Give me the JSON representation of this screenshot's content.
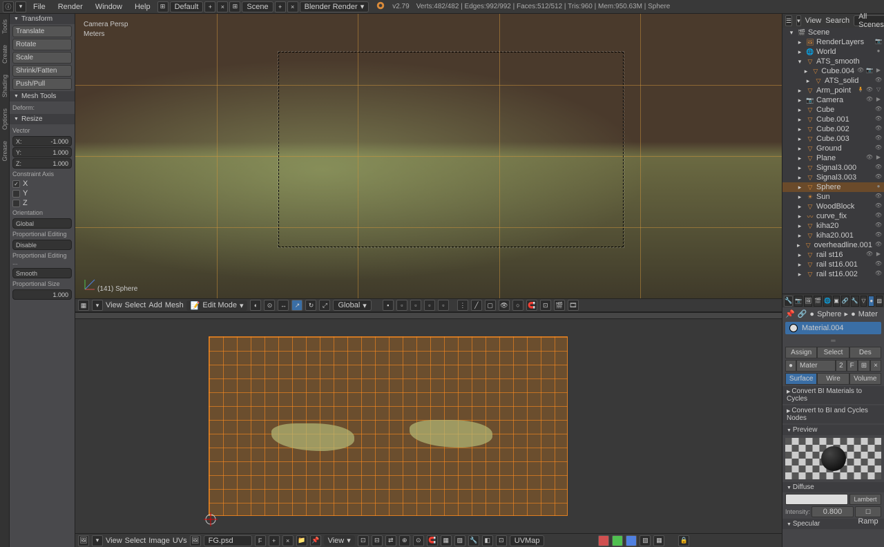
{
  "app": {
    "version": "v2.79",
    "stats": "Verts:482/482 | Edges:992/992 | Faces:512/512 | Tris:960 | Mem:950.63M | Sphere"
  },
  "top_menu": [
    "File",
    "Render",
    "Window",
    "Help"
  ],
  "top_layout": "Default",
  "top_scene": "Scene",
  "top_engine": "Blender Render",
  "left_tabs": [
    "Tools",
    "Create",
    "Shading",
    "Options",
    "Grease"
  ],
  "transform": {
    "title": "Transform",
    "buttons": [
      "Translate",
      "Rotate",
      "Scale",
      "Shrink/Fatten",
      "Push/Pull"
    ]
  },
  "meshtools": {
    "title": "Mesh Tools",
    "deform_label": "Deform:"
  },
  "resize": {
    "title": "Resize",
    "vector_label": "Vector",
    "X": "-1.000",
    "Y": "1.000",
    "Z": "1.000",
    "constraint_label": "Constraint Axis",
    "axes": [
      "X",
      "Y",
      "Z"
    ],
    "orientation_label": "Orientation",
    "orientation": "Global",
    "propedit_label": "Proportional Editing",
    "propedit": "Disable",
    "propfall_label": "Proportional Editing ...",
    "propfall": "Smooth",
    "propsize_label": "Proportional Size",
    "propsize": "1.000"
  },
  "viewport": {
    "persp": "Camera Persp",
    "units": "Meters",
    "selected": "(141) Sphere",
    "menu": [
      "View",
      "Select",
      "Add",
      "Mesh"
    ],
    "mode": "Edit Mode",
    "orient": "Global"
  },
  "uv": {
    "menu": [
      "View",
      "Select",
      "Image",
      "UVs"
    ],
    "image": "FG.psd",
    "view": "View",
    "uvmap": "UVMap"
  },
  "outliner": {
    "head": [
      "View",
      "Search",
      "All Scenes"
    ],
    "items": [
      {
        "d": 0,
        "exp": "-",
        "ico": "🎬",
        "name": "Scene",
        "sel": false,
        "tog": []
      },
      {
        "d": 1,
        "exp": "+",
        "ico": "🖼",
        "name": "RenderLayers",
        "sel": false,
        "tog": [
          "📷"
        ]
      },
      {
        "d": 1,
        "exp": "+",
        "ico": "🌐",
        "name": "World",
        "sel": false,
        "tog": [
          "●"
        ]
      },
      {
        "d": 1,
        "exp": "-",
        "ico": "▽",
        "name": "ATS_smooth",
        "sel": false,
        "tog": []
      },
      {
        "d": 2,
        "exp": "+",
        "ico": "▽",
        "name": "Cube.004",
        "sel": false,
        "tog": [
          "👁",
          "📷",
          "▶"
        ]
      },
      {
        "d": 2,
        "exp": "+",
        "ico": "▽",
        "name": "ATS_solid",
        "sel": false,
        "tog": [
          "👁"
        ]
      },
      {
        "d": 1,
        "exp": "+",
        "ico": "▽",
        "name": "Arm_point",
        "sel": false,
        "tog": [
          "🧍",
          "👁",
          "▽"
        ]
      },
      {
        "d": 1,
        "exp": "+",
        "ico": "📷",
        "name": "Camera",
        "sel": false,
        "tog": [
          "👁",
          "▶"
        ]
      },
      {
        "d": 1,
        "exp": "+",
        "ico": "▽",
        "name": "Cube",
        "sel": false,
        "tog": [
          "👁"
        ]
      },
      {
        "d": 1,
        "exp": "+",
        "ico": "▽",
        "name": "Cube.001",
        "sel": false,
        "tog": [
          "👁"
        ]
      },
      {
        "d": 1,
        "exp": "+",
        "ico": "▽",
        "name": "Cube.002",
        "sel": false,
        "tog": [
          "👁"
        ]
      },
      {
        "d": 1,
        "exp": "+",
        "ico": "▽",
        "name": "Cube.003",
        "sel": false,
        "tog": [
          "👁"
        ]
      },
      {
        "d": 1,
        "exp": "+",
        "ico": "▽",
        "name": "Ground",
        "sel": false,
        "tog": [
          "👁"
        ]
      },
      {
        "d": 1,
        "exp": "+",
        "ico": "▽",
        "name": "Plane",
        "sel": false,
        "tog": [
          "👁",
          "▶"
        ]
      },
      {
        "d": 1,
        "exp": "+",
        "ico": "▽",
        "name": "Signal3.000",
        "sel": false,
        "tog": [
          "👁"
        ]
      },
      {
        "d": 1,
        "exp": "+",
        "ico": "▽",
        "name": "Signal3.003",
        "sel": false,
        "tog": [
          "👁"
        ]
      },
      {
        "d": 1,
        "exp": "+",
        "ico": "▽",
        "name": "Sphere",
        "sel": true,
        "tog": [
          "●"
        ]
      },
      {
        "d": 1,
        "exp": "+",
        "ico": "☀",
        "name": "Sun",
        "sel": false,
        "tog": [
          "👁"
        ]
      },
      {
        "d": 1,
        "exp": "+",
        "ico": "▽",
        "name": "WoodBlock",
        "sel": false,
        "tog": [
          "👁"
        ]
      },
      {
        "d": 1,
        "exp": "+",
        "ico": "〰",
        "name": "curve_fix",
        "sel": false,
        "tog": [
          "👁"
        ]
      },
      {
        "d": 1,
        "exp": "+",
        "ico": "▽",
        "name": "kiha20",
        "sel": false,
        "tog": [
          "👁"
        ]
      },
      {
        "d": 1,
        "exp": "+",
        "ico": "▽",
        "name": "kiha20.001",
        "sel": false,
        "tog": [
          "👁"
        ]
      },
      {
        "d": 1,
        "exp": "+",
        "ico": "▽",
        "name": "overheadline.001",
        "sel": false,
        "tog": [
          "👁"
        ]
      },
      {
        "d": 1,
        "exp": "+",
        "ico": "▽",
        "name": "rail st16",
        "sel": false,
        "tog": [
          "👁",
          "▶"
        ]
      },
      {
        "d": 1,
        "exp": "+",
        "ico": "▽",
        "name": "rail st16.001",
        "sel": false,
        "tog": [
          "👁"
        ]
      },
      {
        "d": 1,
        "exp": "+",
        "ico": "▽",
        "name": "rail st16.002",
        "sel": false,
        "tog": [
          "👁"
        ]
      }
    ]
  },
  "props": {
    "breadcrumb": [
      "📌",
      "🔗",
      "●",
      "Sphere",
      "▸",
      "●",
      "Mater"
    ],
    "material": "Material.004",
    "assign": "Assign",
    "select": "Select",
    "des": "Des",
    "mat_id": "Mater",
    "mat_users": "2",
    "mat_fake": "F",
    "surf": "Surface",
    "wire": "Wire",
    "vol": "Volume",
    "conv1": "Convert BI Materials to Cycles",
    "conv2": "Convert to BI and Cycles Nodes",
    "preview": "Preview",
    "diffuse": "Diffuse",
    "lambert": "Lambert",
    "intensity_lbl": "Intensity:",
    "intensity": "0.800",
    "ramp": "Ramp",
    "specular": "Specular"
  }
}
